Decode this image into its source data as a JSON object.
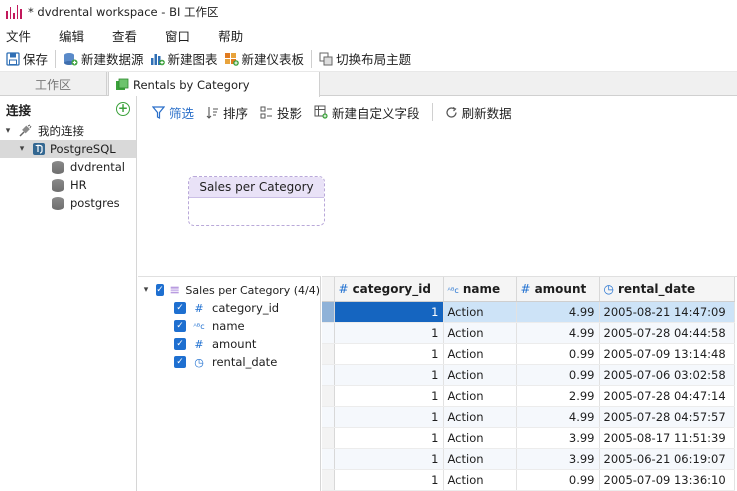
{
  "window": {
    "title": "* dvdrental workspace - BI 工作区"
  },
  "menu": [
    "文件",
    "编辑",
    "查看",
    "窗口",
    "帮助"
  ],
  "toolbar": {
    "save": "保存",
    "new_datasource": "新建数据源",
    "new_chart": "新建图表",
    "new_dashboard": "新建仪表板",
    "switch_theme": "切换布局主题"
  },
  "tabs": {
    "workspace": "工作区",
    "active": "Rentals by Category"
  },
  "connections": {
    "header": "连接",
    "root": "我的连接",
    "server": "PostgreSQL",
    "databases": [
      "dvdrental",
      "HR",
      "postgres"
    ]
  },
  "subtoolbar": {
    "filter": "筛选",
    "sort": "排序",
    "project": "投影",
    "new_field": "新建自定义字段",
    "refresh": "刷新数据"
  },
  "node": {
    "title": "Sales per Category"
  },
  "fields": {
    "title": "Sales per Category (4/4)",
    "items": [
      {
        "name": "category_id",
        "type_icon": "#"
      },
      {
        "name": "name",
        "type_icon": "ABC"
      },
      {
        "name": "amount",
        "type_icon": "#"
      },
      {
        "name": "rental_date",
        "type_icon": "clock"
      }
    ]
  },
  "grid": {
    "columns": [
      "category_id",
      "name",
      "amount",
      "rental_date"
    ],
    "rows": [
      [
        "1",
        "Action",
        "4.99",
        "2005-08-21 14:47:09"
      ],
      [
        "1",
        "Action",
        "4.99",
        "2005-07-28 04:44:58"
      ],
      [
        "1",
        "Action",
        "0.99",
        "2005-07-09 13:14:48"
      ],
      [
        "1",
        "Action",
        "0.99",
        "2005-07-06 03:02:58"
      ],
      [
        "1",
        "Action",
        "2.99",
        "2005-07-28 04:47:14"
      ],
      [
        "1",
        "Action",
        "4.99",
        "2005-07-28 04:57:57"
      ],
      [
        "1",
        "Action",
        "3.99",
        "2005-08-17 11:51:39"
      ],
      [
        "1",
        "Action",
        "3.99",
        "2005-06-21 06:19:07"
      ],
      [
        "1",
        "Action",
        "0.99",
        "2005-07-09 13:36:10"
      ]
    ]
  },
  "colors": {
    "accent": "#1e6fd0",
    "selection": "#1565c0",
    "node_header": "#e9e2f7"
  }
}
